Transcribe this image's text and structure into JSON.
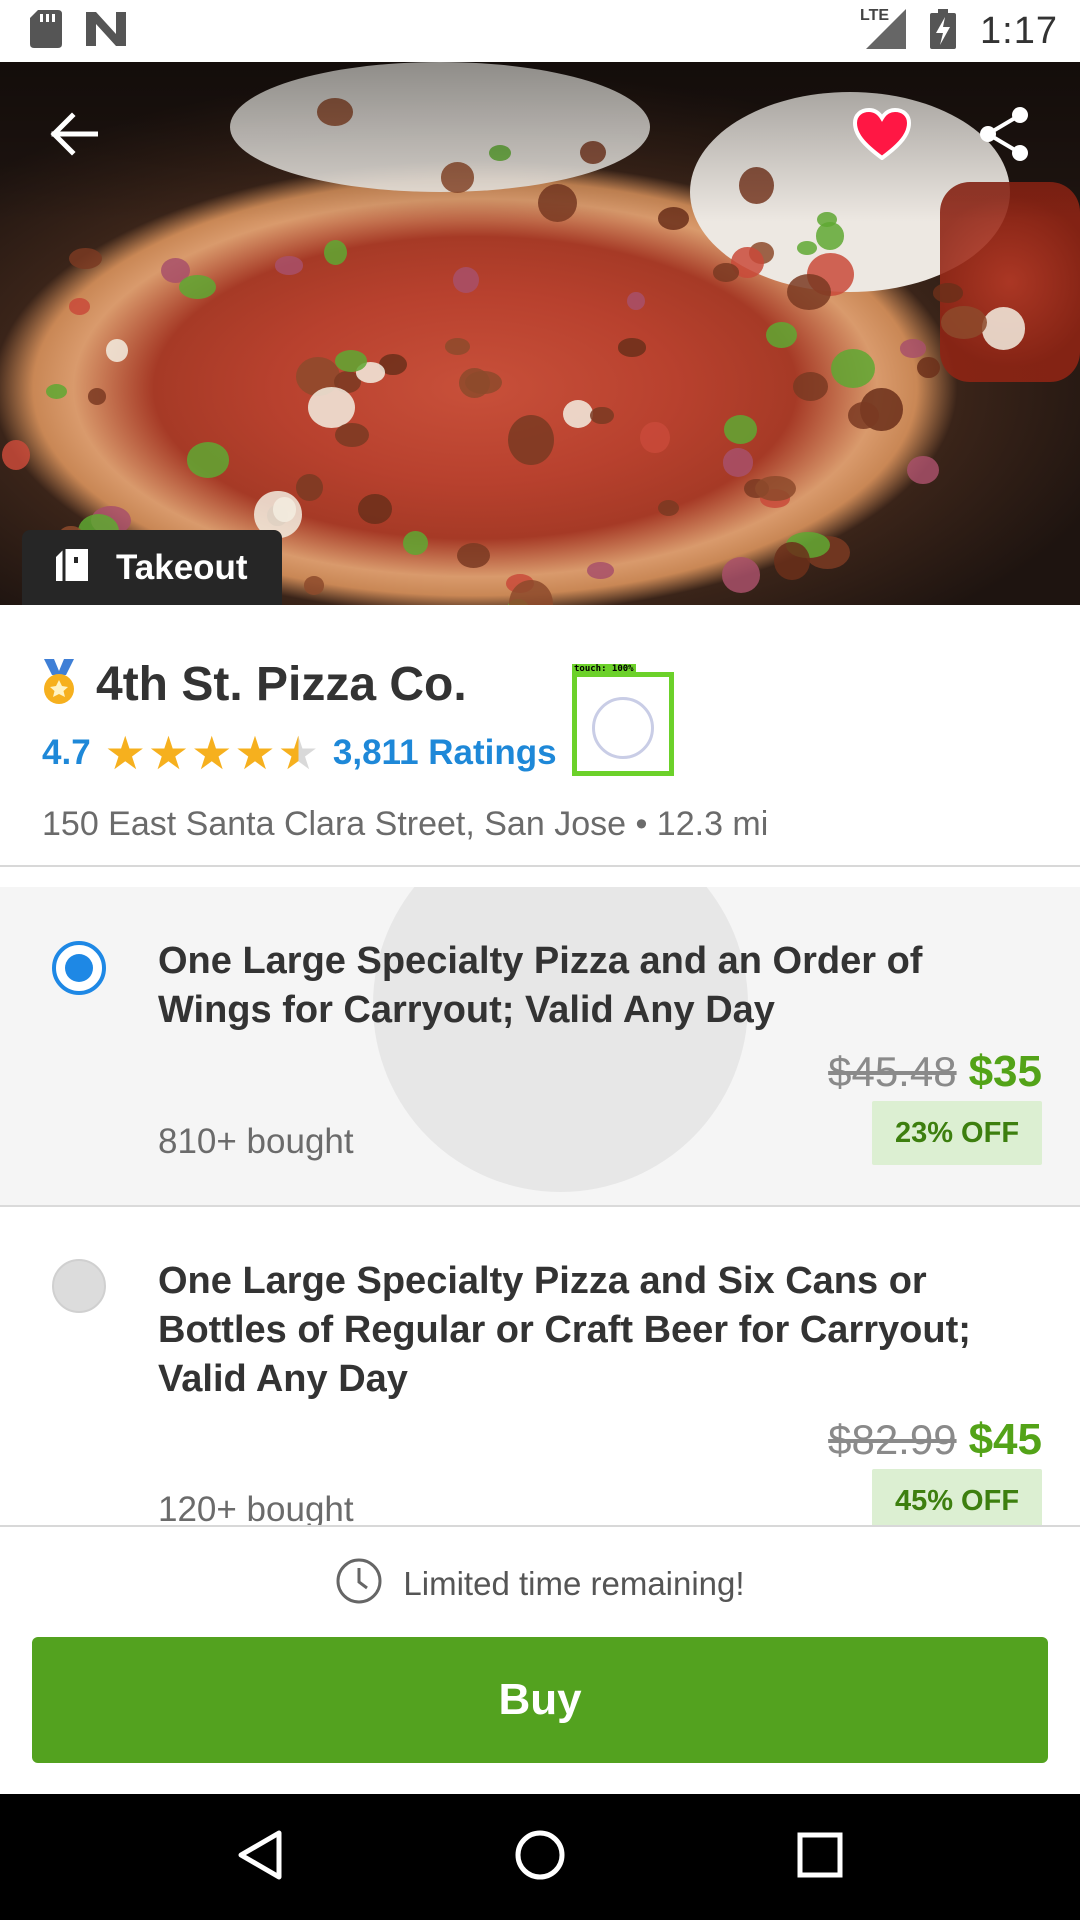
{
  "status_bar": {
    "time": "1:17",
    "network": "LTE",
    "icons": [
      "sd-card-icon",
      "n-notification-icon",
      "signal-icon",
      "battery-charging-icon"
    ]
  },
  "hero": {
    "image_subject": "pizza photo",
    "back_icon": "arrow-left-icon",
    "favorite_icon": "heart-icon",
    "share_icon": "share-icon",
    "badge": {
      "icon": "takeout-bag-icon",
      "label": "Takeout"
    }
  },
  "merchant": {
    "medal_icon": "medal-icon",
    "name": "4th St. Pizza Co.",
    "rating": "4.7",
    "stars": 4.5,
    "ratings_count": "3,811 Ratings",
    "address": "150 East Santa Clara Street, San Jose • 12.3 mi"
  },
  "touch_overlay": {
    "label": "touch: 100%"
  },
  "options": [
    {
      "title": "One Large Specialty Pizza and an Order of Wings for Carryout; Valid Any Day",
      "original_price": "$45.48",
      "price": "$35",
      "bought": "810+ bought",
      "discount": "23% OFF",
      "selected": true
    },
    {
      "title": "One Large Specialty Pizza and Six Cans or Bottles of Regular or Craft Beer for Carryout; Valid Any Day",
      "original_price": "$82.99",
      "price": "$45",
      "bought": "120+ bought",
      "discount": "45% OFF",
      "selected": false
    }
  ],
  "footer": {
    "clock_icon": "clock-icon",
    "limited_text": "Limited time remaining!",
    "buy_label": "Buy"
  },
  "nav": {
    "icons": [
      "back-triangle-icon",
      "home-circle-icon",
      "recents-square-icon"
    ]
  },
  "colors": {
    "accent_blue": "#1e88e5",
    "price_green": "#53a318",
    "buy_green": "#53a21f",
    "star_gold": "#f6b01e",
    "favorite_red": "#ff1744",
    "touch_box_green": "#6cd12a"
  }
}
